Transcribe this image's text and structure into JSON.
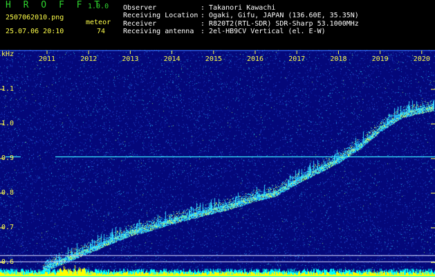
{
  "header": {
    "app_name": "H R O F F T",
    "app_version": "1.0.0",
    "filename": "2507062010.png",
    "datetime": "25.07.06 20:10",
    "counter_label": "meteor",
    "counter_value": "74",
    "info": [
      {
        "label": "Observer",
        "value": ": Takanori Kawachi"
      },
      {
        "label": "Receiving Location",
        "value": ": Ogaki, Gifu, JAPAN (136.60E, 35.35N)"
      },
      {
        "label": "Receiver",
        "value": ": R820T2(RTL-SDR) SDR-Sharp 53.1000MHz"
      },
      {
        "label": "Receiving antenna",
        "value": ": 2el-HB9CV Vertical (el. E-W)"
      }
    ]
  },
  "colors": {
    "background": "#04087a",
    "trace": "#33e0ff",
    "reference_line": "#35e6ff",
    "axis_text": "#ffff4a",
    "bars_yellow": "#ffff00",
    "bars_cyan": "#00ffff"
  },
  "chart_data": {
    "type": "heatmap",
    "ylabel": "kHz",
    "y_ticks": [
      "1.1",
      "1.0",
      "0.9",
      "0.8",
      "0.7",
      "0.6"
    ],
    "x_ticks": [
      "2011",
      "2012",
      "2013",
      "2014",
      "2015",
      "2016",
      "2017",
      "2018",
      "2019",
      "2020"
    ],
    "ylim": [
      0.58,
      1.13
    ],
    "xlim": [
      2010.6,
      2020.3
    ],
    "reference_line_khz": 0.905,
    "trend_series": {
      "x": [
        2010.9,
        2011.5,
        2012.0,
        2012.5,
        2013.0,
        2013.5,
        2014.0,
        2014.5,
        2015.0,
        2015.5,
        2016.0,
        2016.5,
        2017.0,
        2017.5,
        2018.0,
        2018.5,
        2019.0,
        2019.5,
        2020.0,
        2020.3
      ],
      "y": [
        0.58,
        0.61,
        0.635,
        0.66,
        0.685,
        0.7,
        0.72,
        0.735,
        0.75,
        0.765,
        0.785,
        0.8,
        0.835,
        0.865,
        0.895,
        0.935,
        0.985,
        1.025,
        1.04,
        1.045
      ]
    }
  }
}
